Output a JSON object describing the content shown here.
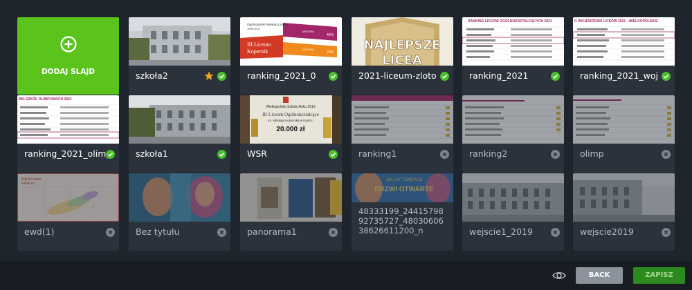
{
  "add_slide": {
    "label": "DODAJ SLAJD"
  },
  "slides": [
    {
      "label": "szkoła2",
      "status": "active",
      "starred": true
    },
    {
      "label": "ranking_2021_0",
      "status": "active",
      "thumb_text": [
        "Ogólnopolski Ranking Liceów",
        "1999-2021",
        "III Liceum",
        "Kopernik",
        "MATURA",
        "PRZEDMIOTY",
        "DODATKOWE",
        "45%",
        "MATURA",
        "PRZEDMIOTY",
        "OBOWIĄZKOWE",
        "23%",
        "35%"
      ]
    },
    {
      "label": "2021-liceum-zloto",
      "status": "active",
      "thumb_text": [
        "NAJLEPSZE",
        "LICEA"
      ]
    },
    {
      "label": "ranking_2021",
      "status": "active",
      "thumb_text": [
        "RANKING LICEÓW OGÓLNOKSZTAŁCĄCYCH 2021"
      ]
    },
    {
      "label": "ranking_2021_woj",
      "status": "active",
      "thumb_text": [
        "G WOJEWÓDZKI LICEÓW 2021 - WIELKOPOLSKIE"
      ]
    },
    {
      "label": "ranking_2021_olimp",
      "status": "active",
      "thumb_text": [
        "ING SZKÓŁ OLIMPIJSKICH 2021"
      ]
    },
    {
      "label": "szkoła1",
      "status": "active"
    },
    {
      "label": "WSR",
      "status": "active",
      "thumb_text": [
        "Wielkopolska Szkoła Roku 2019",
        "III Liceum Ogólnokształcące",
        "im. Mikołaja Kopernika w Kaliszu",
        "20.000 zł"
      ]
    },
    {
      "label": "ranking1",
      "status": "inactive"
    },
    {
      "label": "ranking2",
      "status": "inactive"
    },
    {
      "label": "olimp",
      "status": "inactive"
    },
    {
      "label": "ewd(1)",
      "status": "inactive",
      "thumb_text": [
        "Wyniki matur",
        "kalisk lic"
      ]
    },
    {
      "label": "Bez tytułu",
      "status": "inactive"
    },
    {
      "label": "panorama1",
      "status": "inactive"
    },
    {
      "label": "48333199_24415798 92735727_48030606 38626611200_n",
      "status": "inactive",
      "thumb_text": [
        "100 LAT TRADYCJI",
        "DRZWI OTWARTE"
      ]
    },
    {
      "label": "wejscie1_2019",
      "status": "inactive"
    },
    {
      "label": "wejscie2019",
      "status": "inactive"
    }
  ],
  "footer": {
    "back_label": "BACK",
    "save_label": "ZAPISZ"
  },
  "colors": {
    "background": "#1f252d",
    "tile": "#2b323b",
    "accent_green": "#5ac41d",
    "check_green": "#4bbf2b",
    "star": "#f5a623",
    "save_button": "#2d8a1f",
    "back_button": "#8a929c"
  }
}
